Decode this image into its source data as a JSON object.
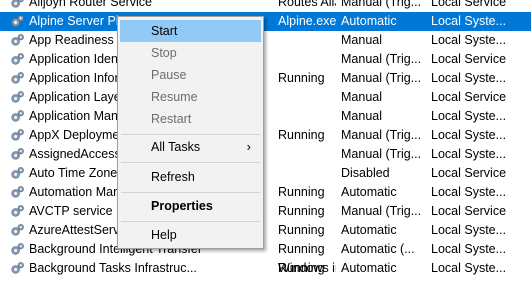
{
  "services": [
    {
      "name": "Alljoyn Router Service",
      "desc": "Routes AllJoyn",
      "status": "",
      "startup": "Manual (Trig...",
      "logon": "Local Service",
      "selected": false
    },
    {
      "name": "Alpine Server Plug-In",
      "desc": "Alpine.exe",
      "status": "",
      "startup": "Automatic",
      "logon": "Local Syste...",
      "selected": true
    },
    {
      "name": "App Readiness",
      "desc": "",
      "status": "",
      "startup": "Manual",
      "logon": "Local Syste...",
      "selected": false
    },
    {
      "name": "Application Identity",
      "desc": "",
      "status": "",
      "startup": "Manual (Trig...",
      "logon": "Local Service",
      "selected": false
    },
    {
      "name": "Application Information",
      "desc": "",
      "status": "Running",
      "startup": "Manual (Trig...",
      "logon": "Local Syste...",
      "selected": false
    },
    {
      "name": "Application Layer Gateway",
      "desc": "",
      "status": "",
      "startup": "Manual",
      "logon": "Local Service",
      "selected": false
    },
    {
      "name": "Application Management",
      "desc": "",
      "status": "",
      "startup": "Manual",
      "logon": "Local Syste...",
      "selected": false
    },
    {
      "name": "AppX Deployment Service",
      "desc": "",
      "status": "Running",
      "startup": "Manual (Trig...",
      "logon": "Local Syste...",
      "selected": false
    },
    {
      "name": "AssignedAccessManager",
      "desc": "",
      "status": "",
      "startup": "Manual (Trig...",
      "logon": "Local Syste...",
      "selected": false
    },
    {
      "name": "Auto Time Zone Updater",
      "desc": "",
      "status": "",
      "startup": "Disabled",
      "logon": "Local Service",
      "selected": false
    },
    {
      "name": "Automation Manager",
      "desc": "",
      "status": "Running",
      "startup": "Automatic",
      "logon": "Local Syste...",
      "selected": false
    },
    {
      "name": "AVCTP service",
      "desc": "",
      "status": "Running",
      "startup": "Manual (Trig...",
      "logon": "Local Service",
      "selected": false
    },
    {
      "name": "AzureAttestService",
      "desc": "",
      "status": "Running",
      "startup": "Automatic",
      "logon": "Local Syste...",
      "selected": false
    },
    {
      "name": "Background Intelligent Transfer",
      "desc": "",
      "status": "Running",
      "startup": "Automatic (...",
      "logon": "Local Syste...",
      "selected": false
    },
    {
      "name": "Background Tasks Infrastruc...",
      "desc": "Windows in...",
      "status": "Running",
      "startup": "Automatic",
      "logon": "Local Syste...",
      "selected": false
    }
  ],
  "context_menu": {
    "start": "Start",
    "stop": "Stop",
    "pause": "Pause",
    "resume": "Resume",
    "restart": "Restart",
    "all_tasks": "All Tasks",
    "refresh": "Refresh",
    "properties": "Properties",
    "help": "Help"
  },
  "colors": {
    "selection": "#0078d7",
    "menu_hover": "#91c9f7",
    "menu_bg": "#f2f2f2"
  },
  "icon": "gear-icon"
}
